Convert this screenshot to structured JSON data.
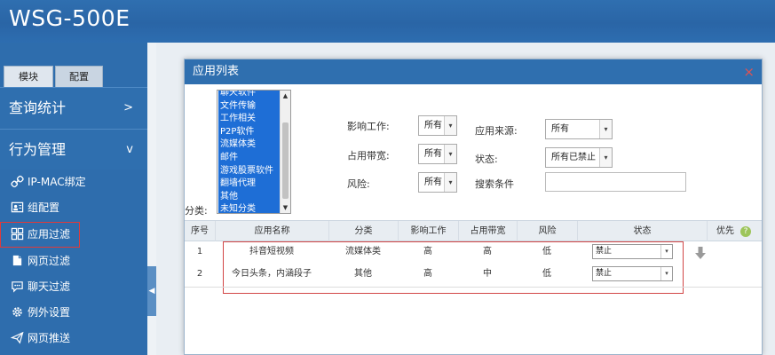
{
  "header": {
    "brand": "WSG-500E"
  },
  "sidebar": {
    "tabs": [
      {
        "label": "模块"
      },
      {
        "label": "配置"
      }
    ],
    "sections": [
      {
        "label": "查询统计",
        "chevron": ">"
      },
      {
        "label": "行为管理",
        "chevron": "v"
      }
    ],
    "items": [
      {
        "label": "IP-MAC绑定",
        "icon": "link-icon"
      },
      {
        "label": "组配置",
        "icon": "group-config-icon"
      },
      {
        "label": "应用过滤",
        "icon": "grid-icon"
      },
      {
        "label": "网页过滤",
        "icon": "webpage-icon"
      },
      {
        "label": "聊天过滤",
        "icon": "chat-icon"
      },
      {
        "label": "例外设置",
        "icon": "gear-icon"
      },
      {
        "label": "网页推送",
        "icon": "send-icon"
      }
    ]
  },
  "modal": {
    "title": "应用列表",
    "close": "×",
    "categories": [
      "聊天软件",
      "文件传输",
      "工作相关",
      "P2P软件",
      "流媒体类",
      "邮件",
      "游戏股票软件",
      "翻墙代理",
      "其他",
      "未知分类"
    ],
    "category_label": "分类:",
    "filters": {
      "impact_label": "影响工作:",
      "impact_value": "所有",
      "bandwidth_label": "占用带宽:",
      "bandwidth_value": "所有",
      "risk_label": "风险:",
      "risk_value": "所有",
      "source_label": "应用来源:",
      "source_value": "所有",
      "status_label": "状态:",
      "status_value": "所有已禁止",
      "search_label": "搜索条件",
      "search_value": ""
    },
    "table": {
      "headers": [
        "序号",
        "应用名称",
        "分类",
        "影响工作",
        "占用带宽",
        "风险",
        "状态",
        "优先"
      ],
      "help": "?",
      "rows": [
        {
          "no": "1",
          "name": "抖音短视频",
          "category": "流媒体类",
          "impact": "高",
          "bandwidth": "高",
          "risk": "低",
          "status": "禁止"
        },
        {
          "no": "2",
          "name": "今日头条，内涵段子",
          "category": "其他",
          "impact": "高",
          "bandwidth": "中",
          "risk": "低",
          "status": "禁止"
        }
      ]
    }
  },
  "colors": {
    "header_blue": "#2f6faf",
    "highlight_red": "#d24646",
    "select_blue": "#1e6ed6"
  }
}
